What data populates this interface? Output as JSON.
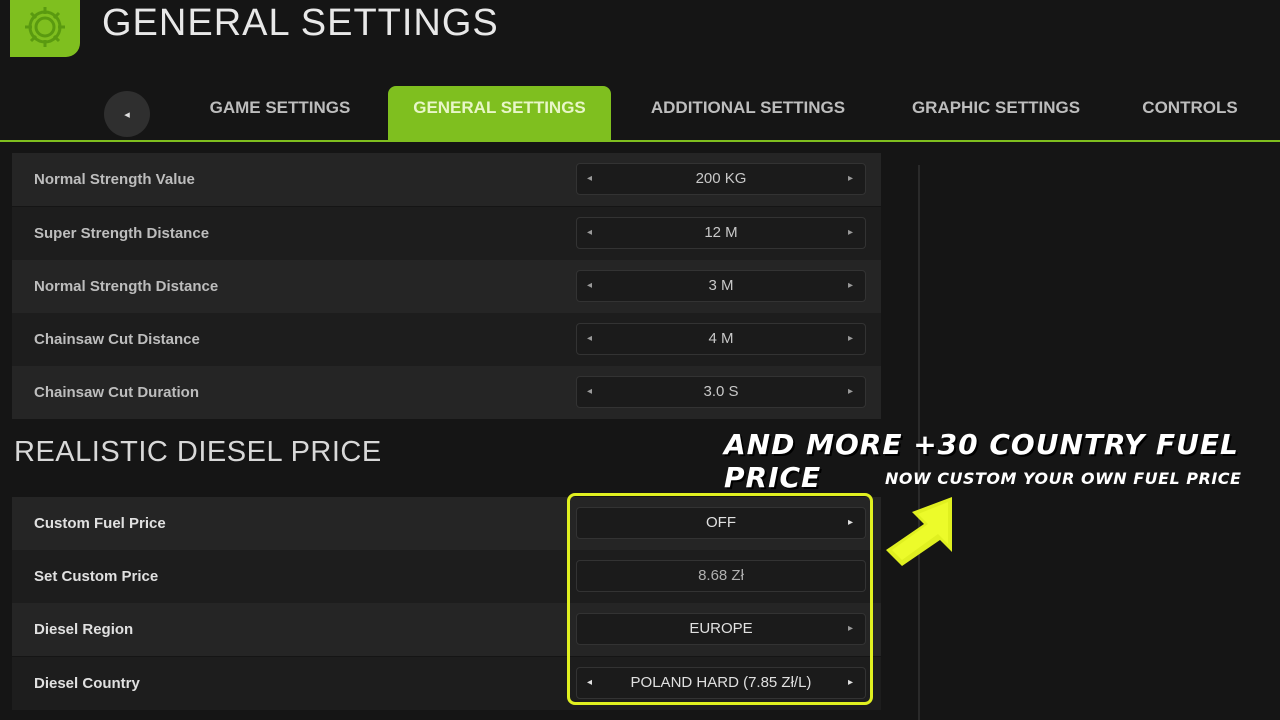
{
  "header": {
    "title": "GENERAL SETTINGS",
    "logo_icon": "gear-icon",
    "accent_color": "#7fbf1f"
  },
  "nav": {
    "back_icon": "back-arrow-icon",
    "tabs": [
      {
        "label": "GAME SETTINGS",
        "active": false
      },
      {
        "label": "GENERAL SETTINGS",
        "active": true
      },
      {
        "label": "ADDITIONAL SETTINGS",
        "active": false
      },
      {
        "label": "GRAPHIC SETTINGS",
        "active": false
      },
      {
        "label": "CONTROLS",
        "active": false
      }
    ]
  },
  "settings": [
    {
      "label": "Normal Strength Value",
      "value": "200 KG"
    },
    {
      "label": "Super Strength Distance",
      "value": "12 M"
    },
    {
      "label": "Normal Strength Distance",
      "value": "3 M"
    },
    {
      "label": "Chainsaw Cut Distance",
      "value": "4 M"
    },
    {
      "label": "Chainsaw Cut Duration",
      "value": "3.0 S"
    }
  ],
  "diesel_section": {
    "title": "REALISTIC DIESEL PRICE",
    "rows": [
      {
        "label": "Custom Fuel Price",
        "value": "OFF"
      },
      {
        "label": "Set Custom Price",
        "value": "8.68 Zł"
      },
      {
        "label": "Diesel Region",
        "value": "EUROPE"
      },
      {
        "label": "Diesel Country",
        "value": "POLAND HARD (7.85 Zł/L)"
      }
    ]
  },
  "arrows": {
    "left": "◂",
    "right": "▸",
    "back": "◂"
  },
  "promo": {
    "headline": "AND MORE +30 COUNTRY FUEL PRICE",
    "subline": "NOW CUSTOM YOUR OWN FUEL PRICE",
    "highlight_color": "#e0f020"
  }
}
